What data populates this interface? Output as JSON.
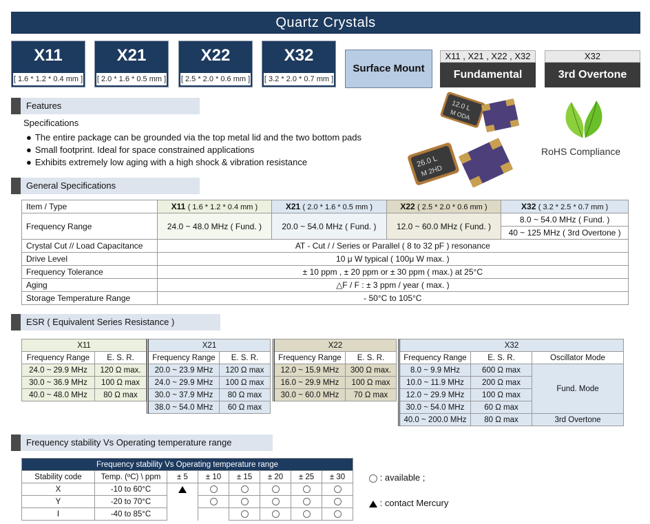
{
  "title": "Quartz  Crystals",
  "models": [
    {
      "name": "X11",
      "dim": "[ 1.6 * 1.2 * 0.4 mm ]"
    },
    {
      "name": "X21",
      "dim": "[ 2.0 * 1.6 * 0.5 mm ]"
    },
    {
      "name": "X22",
      "dim": "[ 2.5 * 2.0 * 0.6 mm ]"
    },
    {
      "name": "X32",
      "dim": "[ 3.2 * 2.0 * 0.7 mm ]"
    }
  ],
  "surface_mount": "Surface Mount",
  "fundamental": {
    "top": "X11 , X21 , X22 , X32",
    "label": "Fundamental"
  },
  "overtone": {
    "top": "X32",
    "label": "3rd Overtone"
  },
  "rohs": "RoHS Compliance",
  "product_marks": [
    "12.0 L",
    "M ODA",
    "26.0 L",
    "M 2HD"
  ],
  "sections": {
    "features": "Features",
    "general": "General Specifications",
    "esr": "ESR ( Equivalent Series Resistance )",
    "stability": "Frequency stability Vs Operating temperature range"
  },
  "specifications_label": "Specifications",
  "features": [
    "The entire package can be grounded via the top metal lid and the two bottom pads",
    "Small footprint. Ideal for space constrained applications",
    "Exhibits extremely low aging with a high shock & vibration resistance"
  ],
  "general_specs": {
    "item_type": "Item / Type",
    "types": [
      {
        "name": "X11",
        "dim": "( 1.6 * 1.2 * 0.4 mm )"
      },
      {
        "name": "X21",
        "dim": "( 2.0 * 1.6 * 0.5 mm )"
      },
      {
        "name": "X22",
        "dim": "( 2.5 * 2.0 * 0.6 mm )"
      },
      {
        "name": "X32",
        "dim": "( 3.2 * 2.5 * 0.7 mm )"
      }
    ],
    "freq_range_label": "Frequency Range",
    "freq_ranges": [
      "24.0 ~ 48.0 MHz ( Fund. )",
      "20.0 ~ 54.0 MHz ( Fund. )",
      "12.0 ~ 60.0 MHz  ( Fund. )",
      "8.0 ~ 54.0 MHz ( Fund. )",
      "40 ~ 125 MHz ( 3rd Overtone )"
    ],
    "rows": [
      {
        "label": "Crystal Cut // Load Capacitance",
        "value": "AT - Cut  / /  Series or Parallel ( 8 to 32 pF ) resonance"
      },
      {
        "label": "Drive Level",
        "value": "10 μ W  typical    ( 100μ W max. )"
      },
      {
        "label": "Frequency Tolerance",
        "value": "± 10 ppm , ± 20 ppm or ± 30 ppm ( max.) at  25°C"
      },
      {
        "label": "Aging",
        "value": "△F / F : ± 3 ppm  /  year ( max. )"
      },
      {
        "label": "Storage Temperature Range",
        "value": "- 50°C to 105°C"
      }
    ]
  },
  "esr_tables": {
    "freq_header": "Frequency Range",
    "esr_header": "E. S. R.",
    "osc_header": "Oscillator Mode",
    "x11": {
      "name": "X11",
      "rows": [
        [
          "24.0 ~ 29.9 MHz",
          "120 Ω max."
        ],
        [
          "30.0 ~ 36.9 MHz",
          "100 Ω max"
        ],
        [
          "40.0 ~ 48.0 MHz",
          "80 Ω max"
        ]
      ]
    },
    "x21": {
      "name": "X21",
      "rows": [
        [
          "20.0 ~ 23.9 MHz",
          "120 Ω max"
        ],
        [
          "24.0 ~ 29.9 MHz",
          "100 Ω max"
        ],
        [
          "30.0 ~ 37.9 MHz",
          "80 Ω max"
        ],
        [
          "38.0 ~ 54.0 MHz",
          "60 Ω max"
        ]
      ]
    },
    "x22": {
      "name": "X22",
      "rows": [
        [
          "12.0 ~ 15.9 MHz",
          "300 Ω max."
        ],
        [
          "16.0 ~ 29.9 MHz",
          "100 Ω max"
        ],
        [
          "30.0 ~ 60.0 MHz",
          "70 Ω max"
        ]
      ]
    },
    "x32": {
      "name": "X32",
      "rows": [
        [
          "8.0 ~ 9.9 MHz",
          "600 Ω max"
        ],
        [
          "10.0 ~ 11.9 MHz",
          "200 Ω max"
        ],
        [
          "12.0 ~ 29.9 MHz",
          "100 Ω max"
        ],
        [
          "30.0 ~ 54.0 MHz",
          "60 Ω max"
        ],
        [
          "40.0 ~ 200.0 MHz",
          "80 Ω max"
        ]
      ],
      "fund_mode": "Fund. Mode",
      "overtone_mode": "3rd Overtone"
    }
  },
  "stability_table": {
    "title": "Frequency stability Vs Operating temperature range",
    "code_header": "Stability code",
    "temp_header": "Temp. (ºC) \\ ppm",
    "ppm": [
      "± 5",
      "± 10",
      "± 15",
      "± 20",
      "± 25",
      "± 30"
    ],
    "rows": [
      {
        "code": "X",
        "temp": "-10  to   60°C"
      },
      {
        "code": "Y",
        "temp": "-20  to  70°C"
      },
      {
        "code": "I",
        "temp": "-40  to  85°C"
      }
    ]
  },
  "legend": {
    "available": ": available   ;",
    "contact": ": contact  Mercury"
  }
}
